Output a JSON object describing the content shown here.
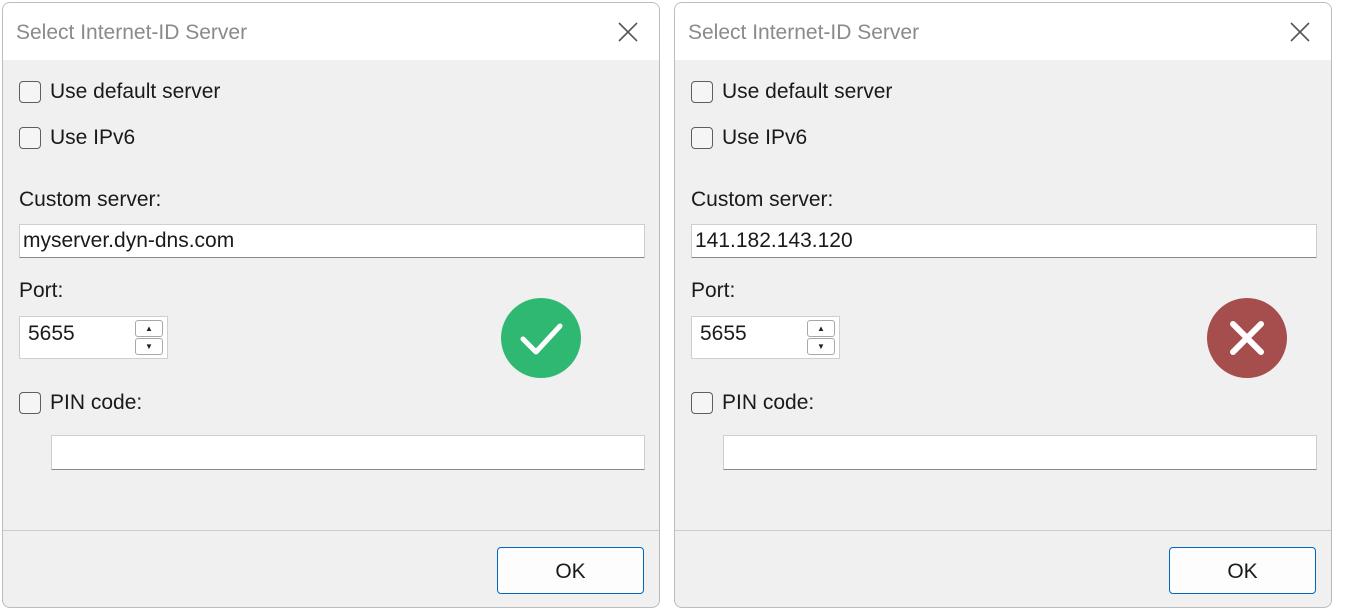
{
  "dialogs": [
    {
      "title": "Select Internet-ID Server",
      "use_default_server": {
        "label": "Use default server",
        "checked": false
      },
      "use_ipv6": {
        "label": "Use IPv6",
        "checked": false
      },
      "custom_server_label": "Custom server:",
      "custom_server_value": "myserver.dyn-dns.com",
      "port_label": "Port:",
      "port_value": "5655",
      "pin_code": {
        "label": "PIN code:",
        "checked": false,
        "value": ""
      },
      "status": {
        "icon": "check-circle-icon",
        "color": "#2fb872"
      },
      "ok_label": "OK"
    },
    {
      "title": "Select Internet-ID Server",
      "use_default_server": {
        "label": "Use default server",
        "checked": false
      },
      "use_ipv6": {
        "label": "Use IPv6",
        "checked": false
      },
      "custom_server_label": "Custom server:",
      "custom_server_value": "141.182.143.120",
      "port_label": "Port:",
      "port_value": "5655",
      "pin_code": {
        "label": "PIN code:",
        "checked": false,
        "value": ""
      },
      "status": {
        "icon": "error-circle-icon",
        "color": "#a64d4d"
      },
      "ok_label": "OK"
    }
  ]
}
